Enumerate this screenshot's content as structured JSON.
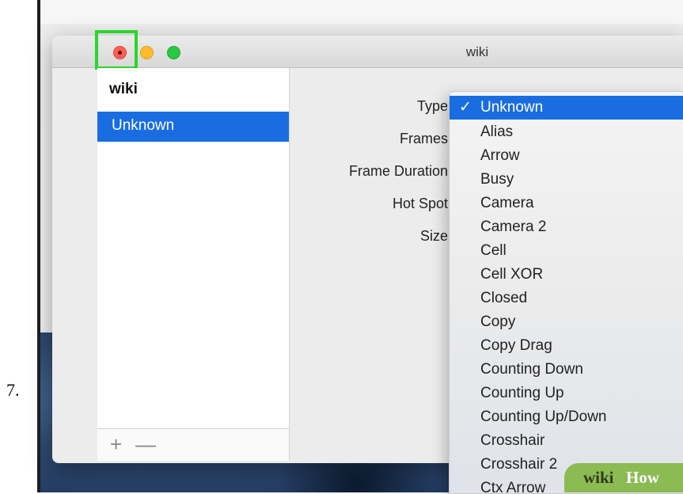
{
  "step": {
    "number": "7."
  },
  "window": {
    "title": "wiki"
  },
  "sidebar": {
    "header": "wiki",
    "items": [
      {
        "label": "Unknown",
        "selected": true
      }
    ],
    "footer": {
      "add": "+",
      "remove": "—"
    }
  },
  "form": {
    "labels": [
      "Type",
      "Frames",
      "Frame Duration",
      "Hot Spot",
      "Size"
    ]
  },
  "dropdown": {
    "selected": "Unknown",
    "check": "✓",
    "options": [
      "Unknown",
      "Alias",
      "Arrow",
      "Busy",
      "Camera",
      "Camera 2",
      "Cell",
      "Cell XOR",
      "Closed",
      "Copy",
      "Copy Drag",
      "Counting Down",
      "Counting Up",
      "Counting Up/Down",
      "Crosshair",
      "Crosshair 2",
      "Ctx Arrow"
    ]
  },
  "watermark": {
    "wiki": "wiki",
    "how": "How"
  },
  "colors": {
    "accent": "#1a6de0",
    "highlight": "#2ad62a",
    "close": "#ff5f57",
    "minimize": "#febc2e",
    "maximize": "#28c840",
    "watermark": "#8cba53"
  }
}
